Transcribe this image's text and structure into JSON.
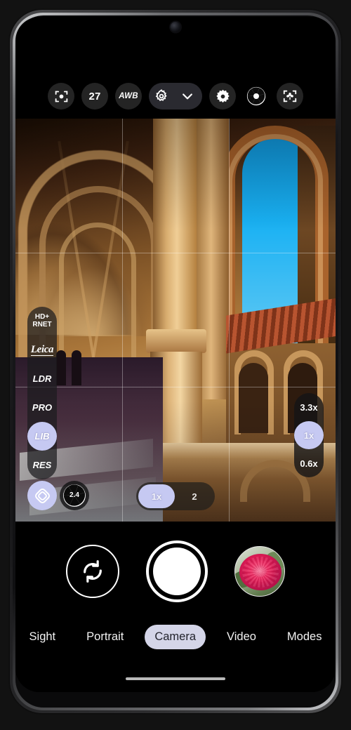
{
  "device": {
    "front_camera_icon": "front-camera-lens",
    "home_indicator": "home-indicator-bar"
  },
  "top_toolbar": {
    "items": [
      {
        "id": "ai-scene",
        "icon": "focus-frame-icon",
        "label": ""
      },
      {
        "id": "shot-count",
        "icon": "",
        "label": "27"
      },
      {
        "id": "white-balance",
        "icon": "",
        "label": "AWB"
      },
      {
        "id": "settings-gear",
        "icon": "gear-outline-icon",
        "label": ""
      },
      {
        "id": "expand-toolbar",
        "icon": "chevron-down-icon",
        "label": ""
      },
      {
        "id": "brightness",
        "icon": "sun-gear-icon",
        "label": ""
      },
      {
        "id": "aperture-mode",
        "icon": "aperture-icon",
        "label": ""
      },
      {
        "id": "macro-mode",
        "icon": "macro-flower-frame-icon",
        "label": ""
      }
    ]
  },
  "viewfinder": {
    "scene_description": "Gothic stone cloister with arches and blue sky",
    "grid": "3x3 rule-of-thirds grid",
    "left_strip": [
      {
        "id": "hd-rnet",
        "label": "HD+\nRNET",
        "active": false
      },
      {
        "id": "leica",
        "label": "Leica",
        "active": false
      },
      {
        "id": "ldr",
        "label": "LDR",
        "active": false
      },
      {
        "id": "pro",
        "label": "PRO",
        "active": false
      },
      {
        "id": "lib",
        "label": "LIB",
        "active": true
      },
      {
        "id": "res",
        "label": "RES",
        "active": false
      }
    ],
    "filter_button": {
      "id": "filter",
      "icon": "filter-diamond-icon"
    },
    "aperture_button": {
      "id": "aperture",
      "icon": "aperture-blades-icon",
      "value": "2.4"
    },
    "zoom_strip": [
      {
        "id": "zoom-33",
        "label": "3.3x",
        "active": false
      },
      {
        "id": "zoom-1",
        "label": "1x",
        "active": true
      },
      {
        "id": "zoom-06",
        "label": "0.6x",
        "active": false
      }
    ],
    "lens_pill": [
      {
        "id": "lens-1x",
        "label": "1x",
        "active": true
      },
      {
        "id": "lens-2",
        "label": "2",
        "active": false
      }
    ]
  },
  "controls": {
    "flip_camera": {
      "id": "flip-camera",
      "icon": "camera-flip-icon"
    },
    "shutter": {
      "id": "shutter",
      "icon": "shutter-button"
    },
    "gallery": {
      "id": "gallery",
      "icon": "gallery-thumbnail-rose"
    }
  },
  "mode_bar": {
    "modes": [
      {
        "id": "sight",
        "label": "Sight",
        "active": false
      },
      {
        "id": "portrait",
        "label": "Portrait",
        "active": false
      },
      {
        "id": "camera",
        "label": "Camera",
        "active": true
      },
      {
        "id": "video",
        "label": "Video",
        "active": false
      },
      {
        "id": "modes",
        "label": "Modes",
        "active": false
      }
    ]
  },
  "colors": {
    "accent_lavender": "#c6c9f2",
    "mode_pill": "#d4d5e8",
    "toolbar_chip": "#242424",
    "sky_blue": "#17b4f5",
    "background": "#000000"
  }
}
